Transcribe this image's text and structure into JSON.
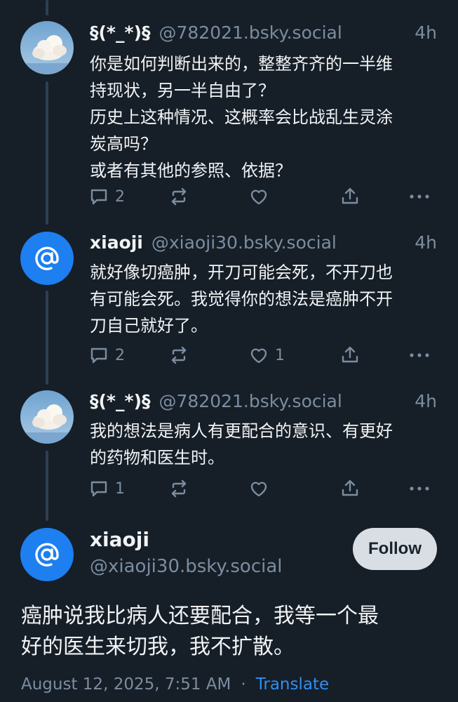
{
  "colors": {
    "background": "#161e27",
    "text": "#f1f3f5",
    "muted": "#7b8da0",
    "accent": "#1d7ff0",
    "link": "#2f8ff5",
    "follow_bg": "#d9dee4"
  },
  "replies": [
    {
      "display_name": "§(*_*)§",
      "handle": "@782021.bsky.social",
      "time": "4h",
      "avatar_icon": "cloud-sky-avatar",
      "text": "你是如何判断出来的，整整齐齐的一半维\n持现状，另一半自由了？\n历史上这种情况、这概率会比战乱生灵涂\n炭高吗？\n或者有其他的参照、依据？",
      "reply_count": "2",
      "like_count": ""
    },
    {
      "display_name": "xiaoji",
      "handle": "@xiaoji30.bsky.social",
      "time": "4h",
      "avatar_icon": "at-sign-avatar",
      "text": "就好像切癌肿，开刀可能会死，不开刀也\n有可能会死。我觉得你的想法是癌肿不开\n刀自己就好了。",
      "reply_count": "2",
      "like_count": "1"
    },
    {
      "display_name": "§(*_*)§",
      "handle": "@782021.bsky.social",
      "time": "4h",
      "avatar_icon": "cloud-sky-avatar",
      "text": "我的想法是病人有更配合的意识、有更好\n的药物和医生时。",
      "reply_count": "1",
      "like_count": ""
    }
  ],
  "main_post": {
    "display_name": "xiaoji",
    "handle": "@xiaoji30.bsky.social",
    "follow_label": "Follow",
    "text": "癌肿说我比病人还要配合，我等一个最\n好的医生来切我，我不扩散。",
    "timestamp": "August 12, 2025, 7:51 AM",
    "separator": "·",
    "translate_label": "Translate"
  }
}
